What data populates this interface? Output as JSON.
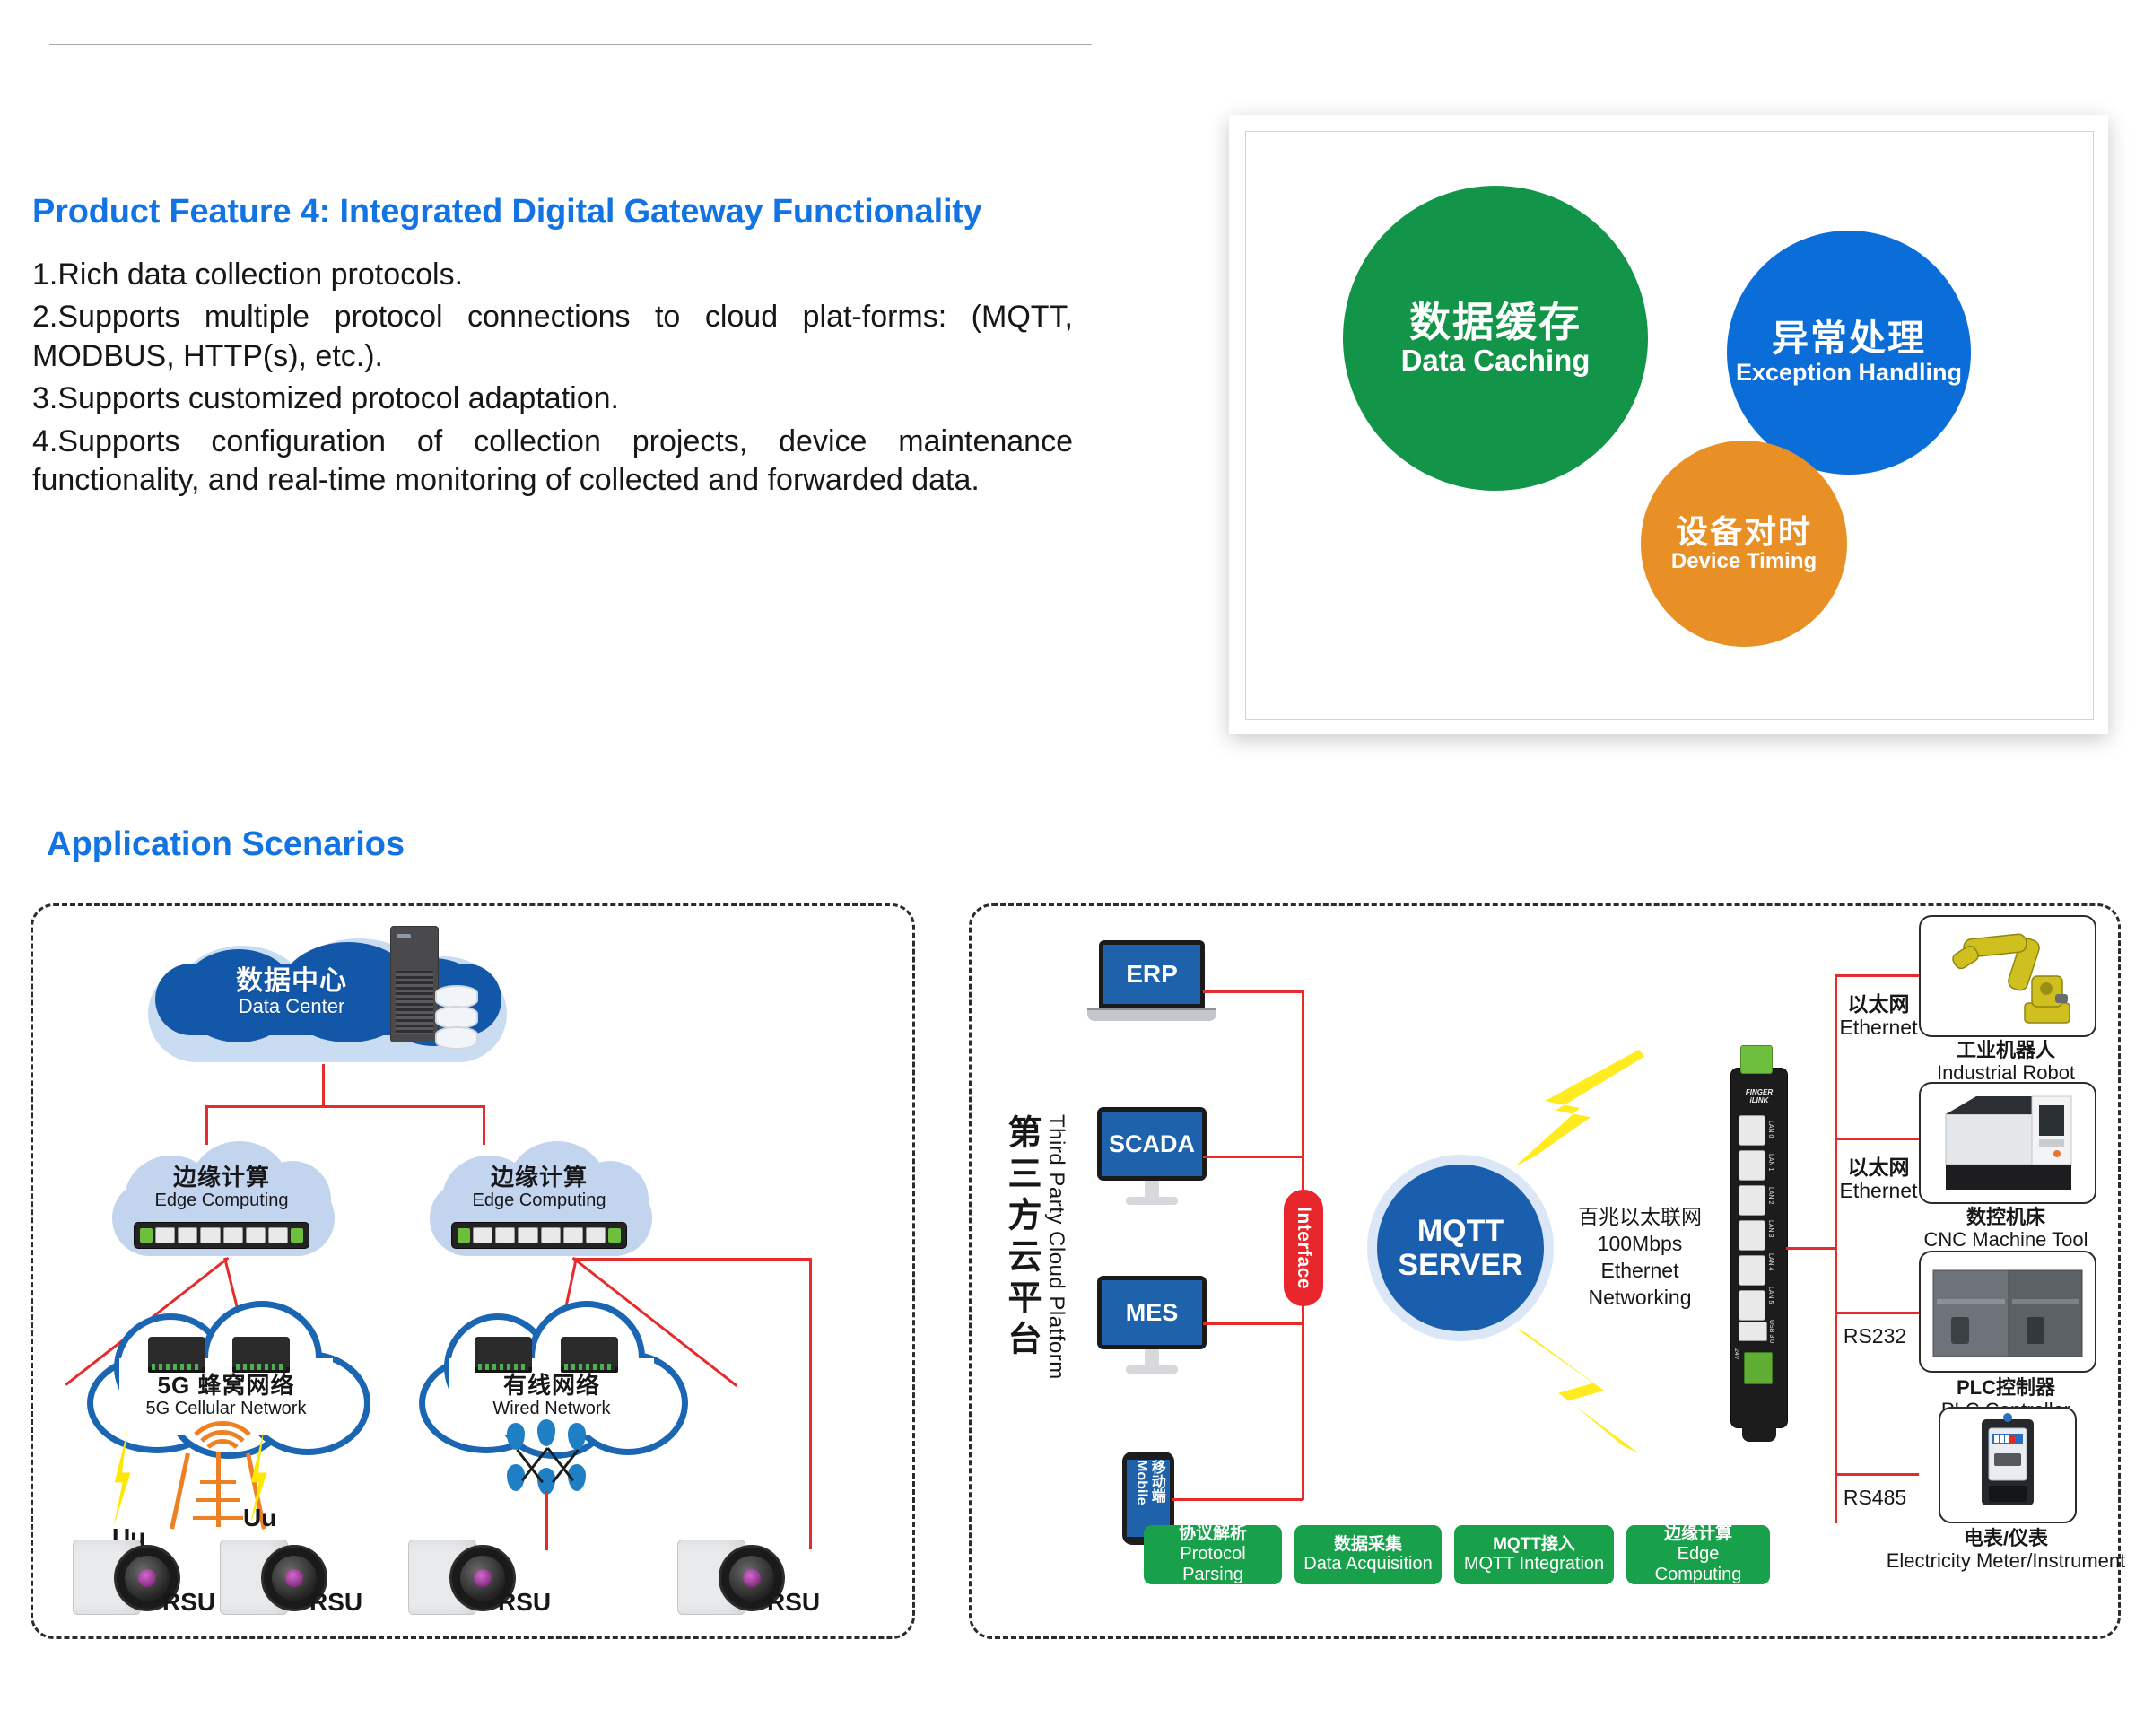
{
  "feature": {
    "title": "Product Feature 4: Integrated Digital Gateway Functionality",
    "lines": [
      "1.Rich data collection protocols.",
      "2.Supports multiple protocol connections to cloud plat-forms: (MQTT, MODBUS, HTTP(s), etc.).",
      "3.Supports customized protocol adaptation.",
      "4.Supports configuration of collection projects, device maintenance functionality, and real-time monitoring of collected and forwarded data."
    ],
    "line1": "1.Rich data collection protocols.",
    "line2": "2.Supports multiple protocol connections to cloud plat-forms: (MQTT, MODBUS, HTTP(s), etc.).",
    "line3": "3.Supports customized protocol adaptation.",
    "line4": "4.Supports configuration of collection projects, device maintenance functionality, and real-time monitoring of collected and forwarded data."
  },
  "bubbles": [
    {
      "cn": "数据缓存",
      "en": "Data Caching",
      "color": "#129549"
    },
    {
      "cn": "异常处理",
      "en": "Exception Handling",
      "color": "#0b6ed8"
    },
    {
      "cn": "设备对时",
      "en": "Device Timing",
      "color": "#e88f26"
    }
  ],
  "scenarios": {
    "heading": "Application Scenarios",
    "left": {
      "data_center": {
        "cn": "数据中心",
        "en": "Data Center"
      },
      "edge_1": {
        "cn": "边缘计算",
        "en": "Edge Computing"
      },
      "edge_2": {
        "cn": "边缘计算",
        "en": "Edge Computing"
      },
      "net_5g": {
        "cn": "5G 蜂窝网络",
        "en": "5G Cellular Network"
      },
      "net_wired": {
        "cn": "有线网络",
        "en": "Wired Network"
      },
      "uu_1": "Uu",
      "uu_2": "Uu",
      "rsu": [
        "RSU",
        "RSU",
        "RSU",
        "RSU"
      ]
    },
    "right": {
      "cloud_platform": {
        "cn": "第三方云平台",
        "en": "Third Party Cloud Platform"
      },
      "clients": [
        {
          "label": "ERP",
          "type": "laptop"
        },
        {
          "label": "SCADA",
          "type": "monitor"
        },
        {
          "label": "MES",
          "type": "monitor"
        },
        {
          "cn": "移动端",
          "en": "Mobile",
          "type": "phone"
        }
      ],
      "interface_label": "Interface",
      "mqtt_line1": "MQTT",
      "mqtt_line2": "SERVER",
      "ethernet_note": {
        "l1": "百兆以太联网",
        "l2": "100Mbps",
        "l3": "Ethernet",
        "l4": "Networking"
      },
      "gateway": {
        "brand_l1": "FINGER",
        "brand_l2": "iLINK",
        "ports": [
          "LAN 0",
          "LAN 1",
          "LAN 2",
          "LAN 3",
          "LAN 4",
          "LAN 5"
        ],
        "usb": "USB 3.0",
        "power": "24V"
      },
      "links": [
        {
          "cn": "以太网",
          "en": "Ethernet"
        },
        {
          "cn": "以太网",
          "en": "Ethernet"
        },
        {
          "cn": "",
          "en": "RS232"
        },
        {
          "cn": "",
          "en": "RS485"
        }
      ],
      "devices": [
        {
          "cn": "工业机器人",
          "en": "Industrial Robot"
        },
        {
          "cn": "数控机床",
          "en": "CNC Machine Tool"
        },
        {
          "cn": "PLC控制器",
          "en": "PLC Controller"
        },
        {
          "cn": "电表/仪表",
          "en": "Electricity Meter/Instrument"
        }
      ],
      "pills": [
        {
          "cn": "协议解析",
          "en": "Protocol Parsing"
        },
        {
          "cn": "数据采集",
          "en": "Data Acquisition"
        },
        {
          "cn": "MQTT接入",
          "en": "MQTT Integration"
        },
        {
          "cn": "边缘计算",
          "en": "Edge Computing"
        }
      ]
    }
  },
  "colors": {
    "heading_blue": "#1274e3",
    "green": "#129549",
    "blue": "#0b6ed8",
    "orange": "#e88f26",
    "wire_red": "#e52b2b",
    "pill_green": "#18a04a",
    "cloud_dark_blue": "#1357a8",
    "cloud_light_blue": "#c3d4ef"
  }
}
